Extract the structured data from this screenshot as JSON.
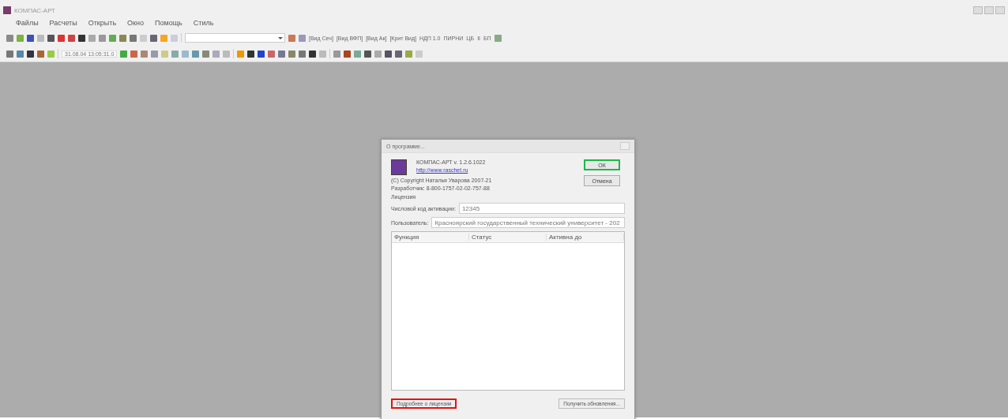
{
  "window": {
    "title": "КОМПАС-АРТ"
  },
  "menu": [
    "Файлы",
    "Расчеты",
    "Открыть",
    "Окно",
    "Помощь",
    "Стиль"
  ],
  "toolbar_1": {
    "text_items": [
      "[Вид Сеч]",
      "[Вид ВФП]",
      "[Вид Ак]",
      "[Крит Вид]",
      "НДП 1.0",
      "ПИРНИ",
      "ЦБ",
      "II",
      "БП"
    ]
  },
  "toolbar_2": {
    "time_field": "31.08.04  13:05:31.0"
  },
  "dialog": {
    "title": "О программе...",
    "product": "КОМПАС-АРТ v. 1.2.6.1022",
    "link": "http://www.raschet.ru",
    "copyright": "(С) Copyright Наталья Уварова 2007-21",
    "contacts": "Разработчик: 8-800-1757-02-02-757-88",
    "license_heading": "Лицензия",
    "fields": [
      {
        "label": "Числовой код активации:",
        "value": "12345"
      },
      {
        "label": "Пользователь:",
        "value": "Красноярский государственный технический университет - 202"
      }
    ],
    "columns": [
      "Функция",
      "Статус",
      "Активна до"
    ],
    "buttons": [
      {
        "label": "ОК",
        "highlighted": true
      },
      {
        "label": "Отмена",
        "highlighted": false
      }
    ],
    "footer_buttons": [
      {
        "label": "Подробнее о лицензии",
        "highlighted": true
      },
      {
        "label": "Получить обновления...",
        "highlighted": false
      }
    ]
  }
}
